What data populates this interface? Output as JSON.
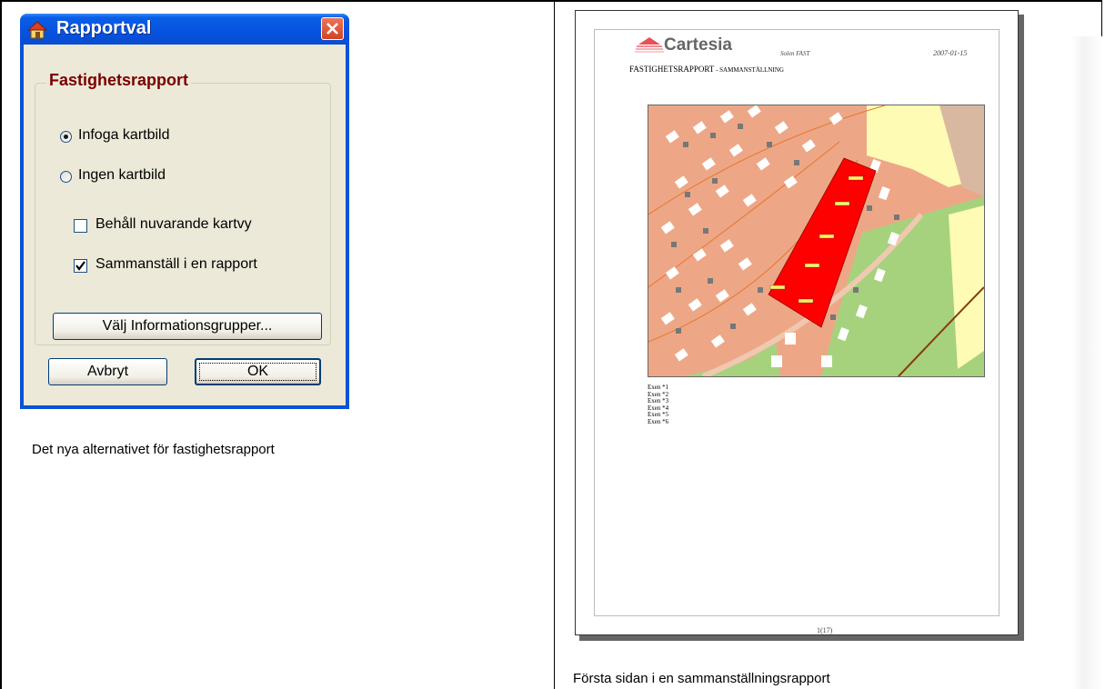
{
  "dialog": {
    "title": "Rapportval",
    "group_label": "Fastighetsrapport",
    "radio_map": "Infoga kartbild",
    "radio_no_map": "Ingen kartbild",
    "check_keep_view": "Behåll nuvarande kartvy",
    "check_compile": "Sammanställ i en rapport",
    "choose_groups_button": "Välj Informationsgrupper...",
    "cancel_button": "Avbryt",
    "ok_button": "OK"
  },
  "captions": {
    "left": "Det nya alternativet för fastighetsrapport",
    "right": "Första sidan i en sammanställningsrapport"
  },
  "report": {
    "logo": "Cartesia",
    "system": "Solen FAST",
    "date": "2007-01-15",
    "title": "FASTIGHETSRAPPORT",
    "subtitle": " - SAMMANSTÄLLNING",
    "items": [
      "Exen *1",
      "Exen *2",
      "Exen *3",
      "Exen *4",
      "Exen *5",
      "Exen *6"
    ],
    "page_number": "1(17)"
  },
  "colors": {
    "xp_blue": "#0a52d8",
    "dialog_face": "#ece9d8",
    "group_label": "#7a0000",
    "map_residential": "#eda787",
    "map_selected": "#ff0000",
    "map_green": "#a6d27e",
    "map_yellow": "#fdfbb4"
  }
}
